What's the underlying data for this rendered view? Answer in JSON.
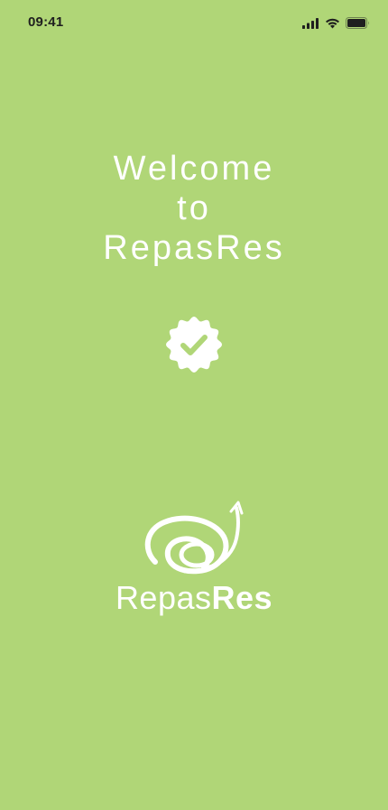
{
  "status_bar": {
    "time": "09:41",
    "icons": [
      "cellular-signal-icon",
      "wifi-icon",
      "battery-icon"
    ]
  },
  "welcome": {
    "line1": "Welcome",
    "line2": "to",
    "line3": "RepasRes"
  },
  "badge": {
    "icon": "check-badge-icon"
  },
  "logo": {
    "text_light": "Repas",
    "text_bold": "Res",
    "icon": "repasres-logo-mark"
  },
  "colors": {
    "background": "#b0d677",
    "foreground": "#ffffff",
    "status_text": "#1f1f1f"
  }
}
